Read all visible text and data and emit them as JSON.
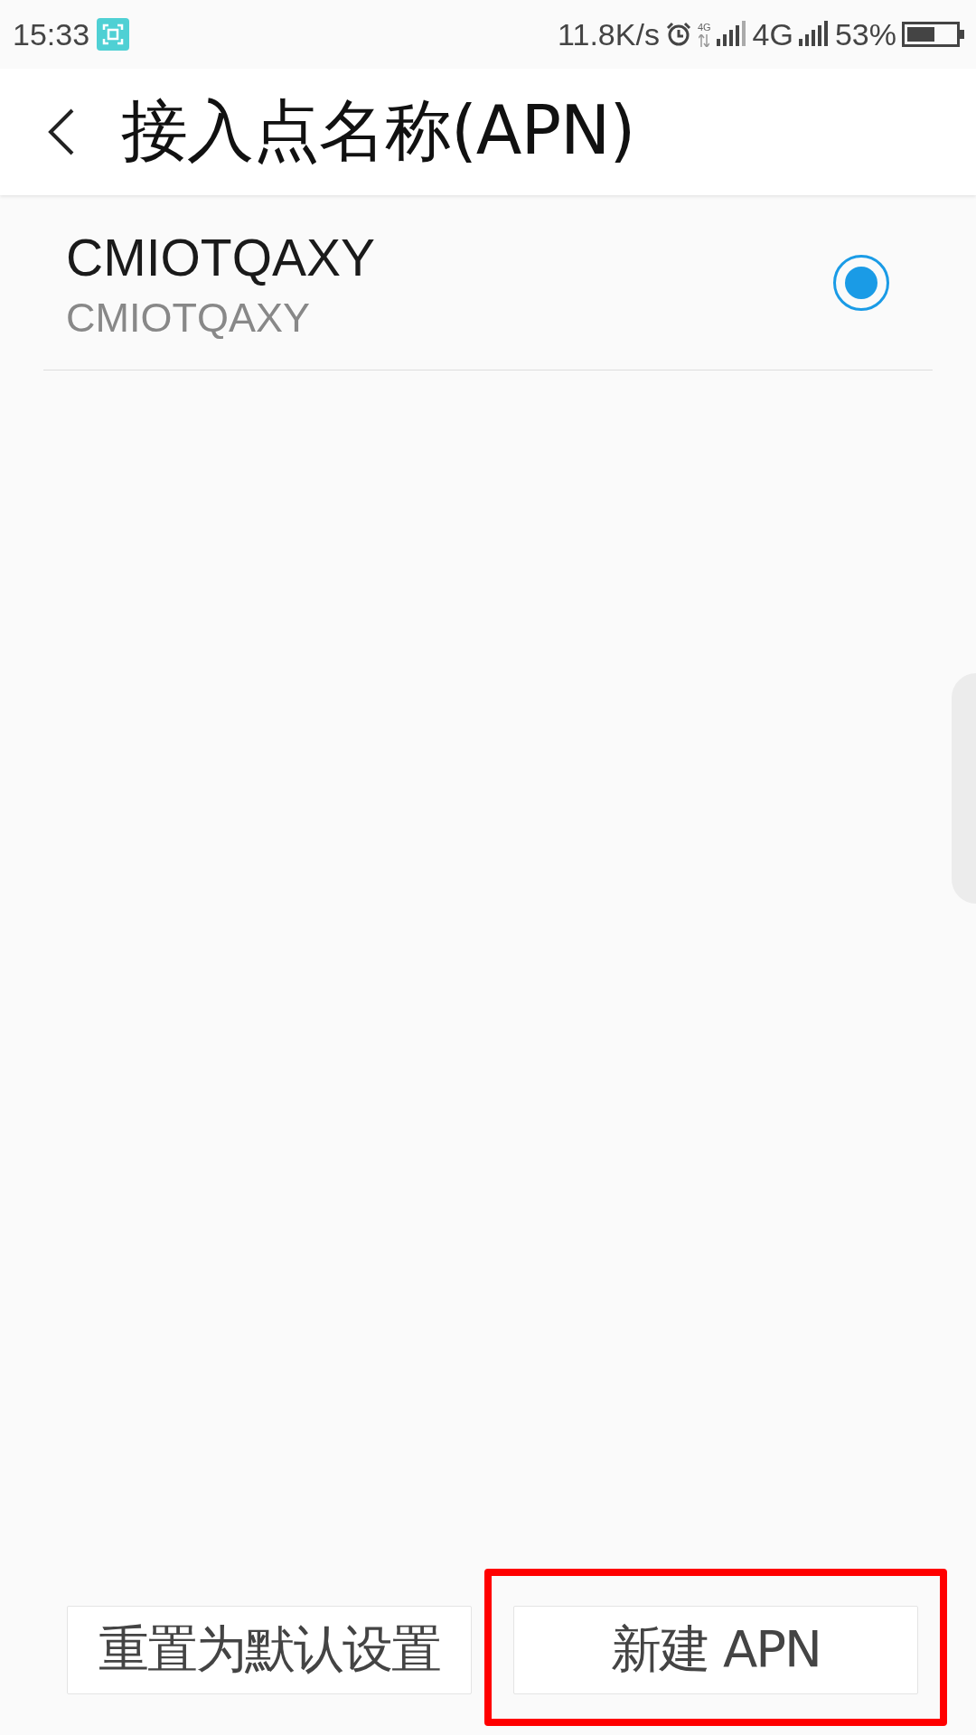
{
  "status_bar": {
    "time": "15:33",
    "speed": "11.8K/s",
    "sim1_network": "4G",
    "sim2_network": "4G",
    "battery": "53%"
  },
  "header": {
    "title": "接入点名称(APN)"
  },
  "apns": [
    {
      "name": "CMIOTQAXY",
      "apn": "CMIOTQAXY",
      "selected": true
    }
  ],
  "buttons": [
    {
      "label": "重置为默认设置",
      "highlighted": false
    },
    {
      "label": "新建 APN",
      "highlighted": true
    }
  ]
}
